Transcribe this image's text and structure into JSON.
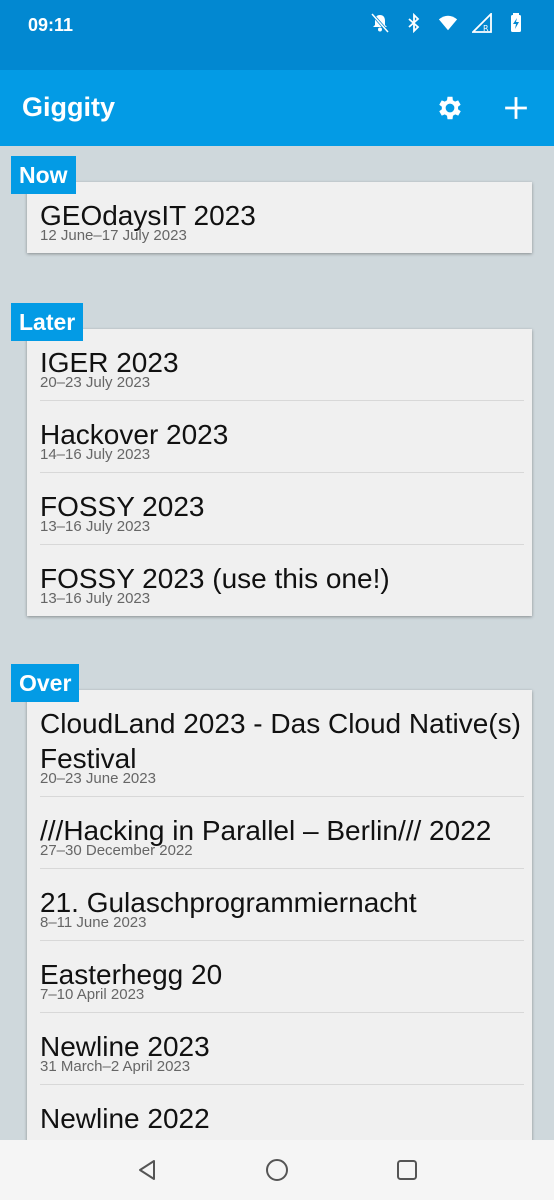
{
  "status": {
    "time": "09:11",
    "icons": [
      "bell-off-icon",
      "bluetooth-icon",
      "wifi-icon",
      "signal-icon",
      "battery-icon"
    ],
    "signal_badge": "R"
  },
  "app": {
    "title": "Giggity",
    "actions": [
      "settings-icon",
      "add-icon"
    ],
    "colors": {
      "app_bar": "#039be5",
      "status_bar": "#0288d1",
      "background": "#cfd8dc"
    }
  },
  "sections": [
    {
      "header": "Now",
      "items": [
        {
          "title": "GEOdaysIT 2023",
          "date": "12 June–17 July 2023"
        }
      ]
    },
    {
      "header": "Later",
      "items": [
        {
          "title": "IGER 2023",
          "date": "20–23 July 2023"
        },
        {
          "title": "Hackover 2023",
          "date": "14–16 July 2023"
        },
        {
          "title": "FOSSY 2023",
          "date": "13–16 July 2023"
        },
        {
          "title": "FOSSY 2023 (use this one!)",
          "date": "13–16 July 2023"
        }
      ]
    },
    {
      "header": "Over",
      "items": [
        {
          "title": "CloudLand 2023 - Das Cloud Native(s) Festival",
          "date": "20–23 June 2023"
        },
        {
          "title": "///Hacking in Parallel – Berlin/// 2022",
          "date": "27–30 December 2022"
        },
        {
          "title": "21. Gulaschprogrammiernacht",
          "date": "8–11 June 2023"
        },
        {
          "title": "Easterhegg 20",
          "date": "7–10 April 2023"
        },
        {
          "title": "Newline 2023",
          "date": "31 March–2 April 2023"
        },
        {
          "title": "Newline 2022",
          "date": ""
        }
      ]
    }
  ],
  "nav": [
    "back-icon",
    "home-icon",
    "recents-icon"
  ]
}
